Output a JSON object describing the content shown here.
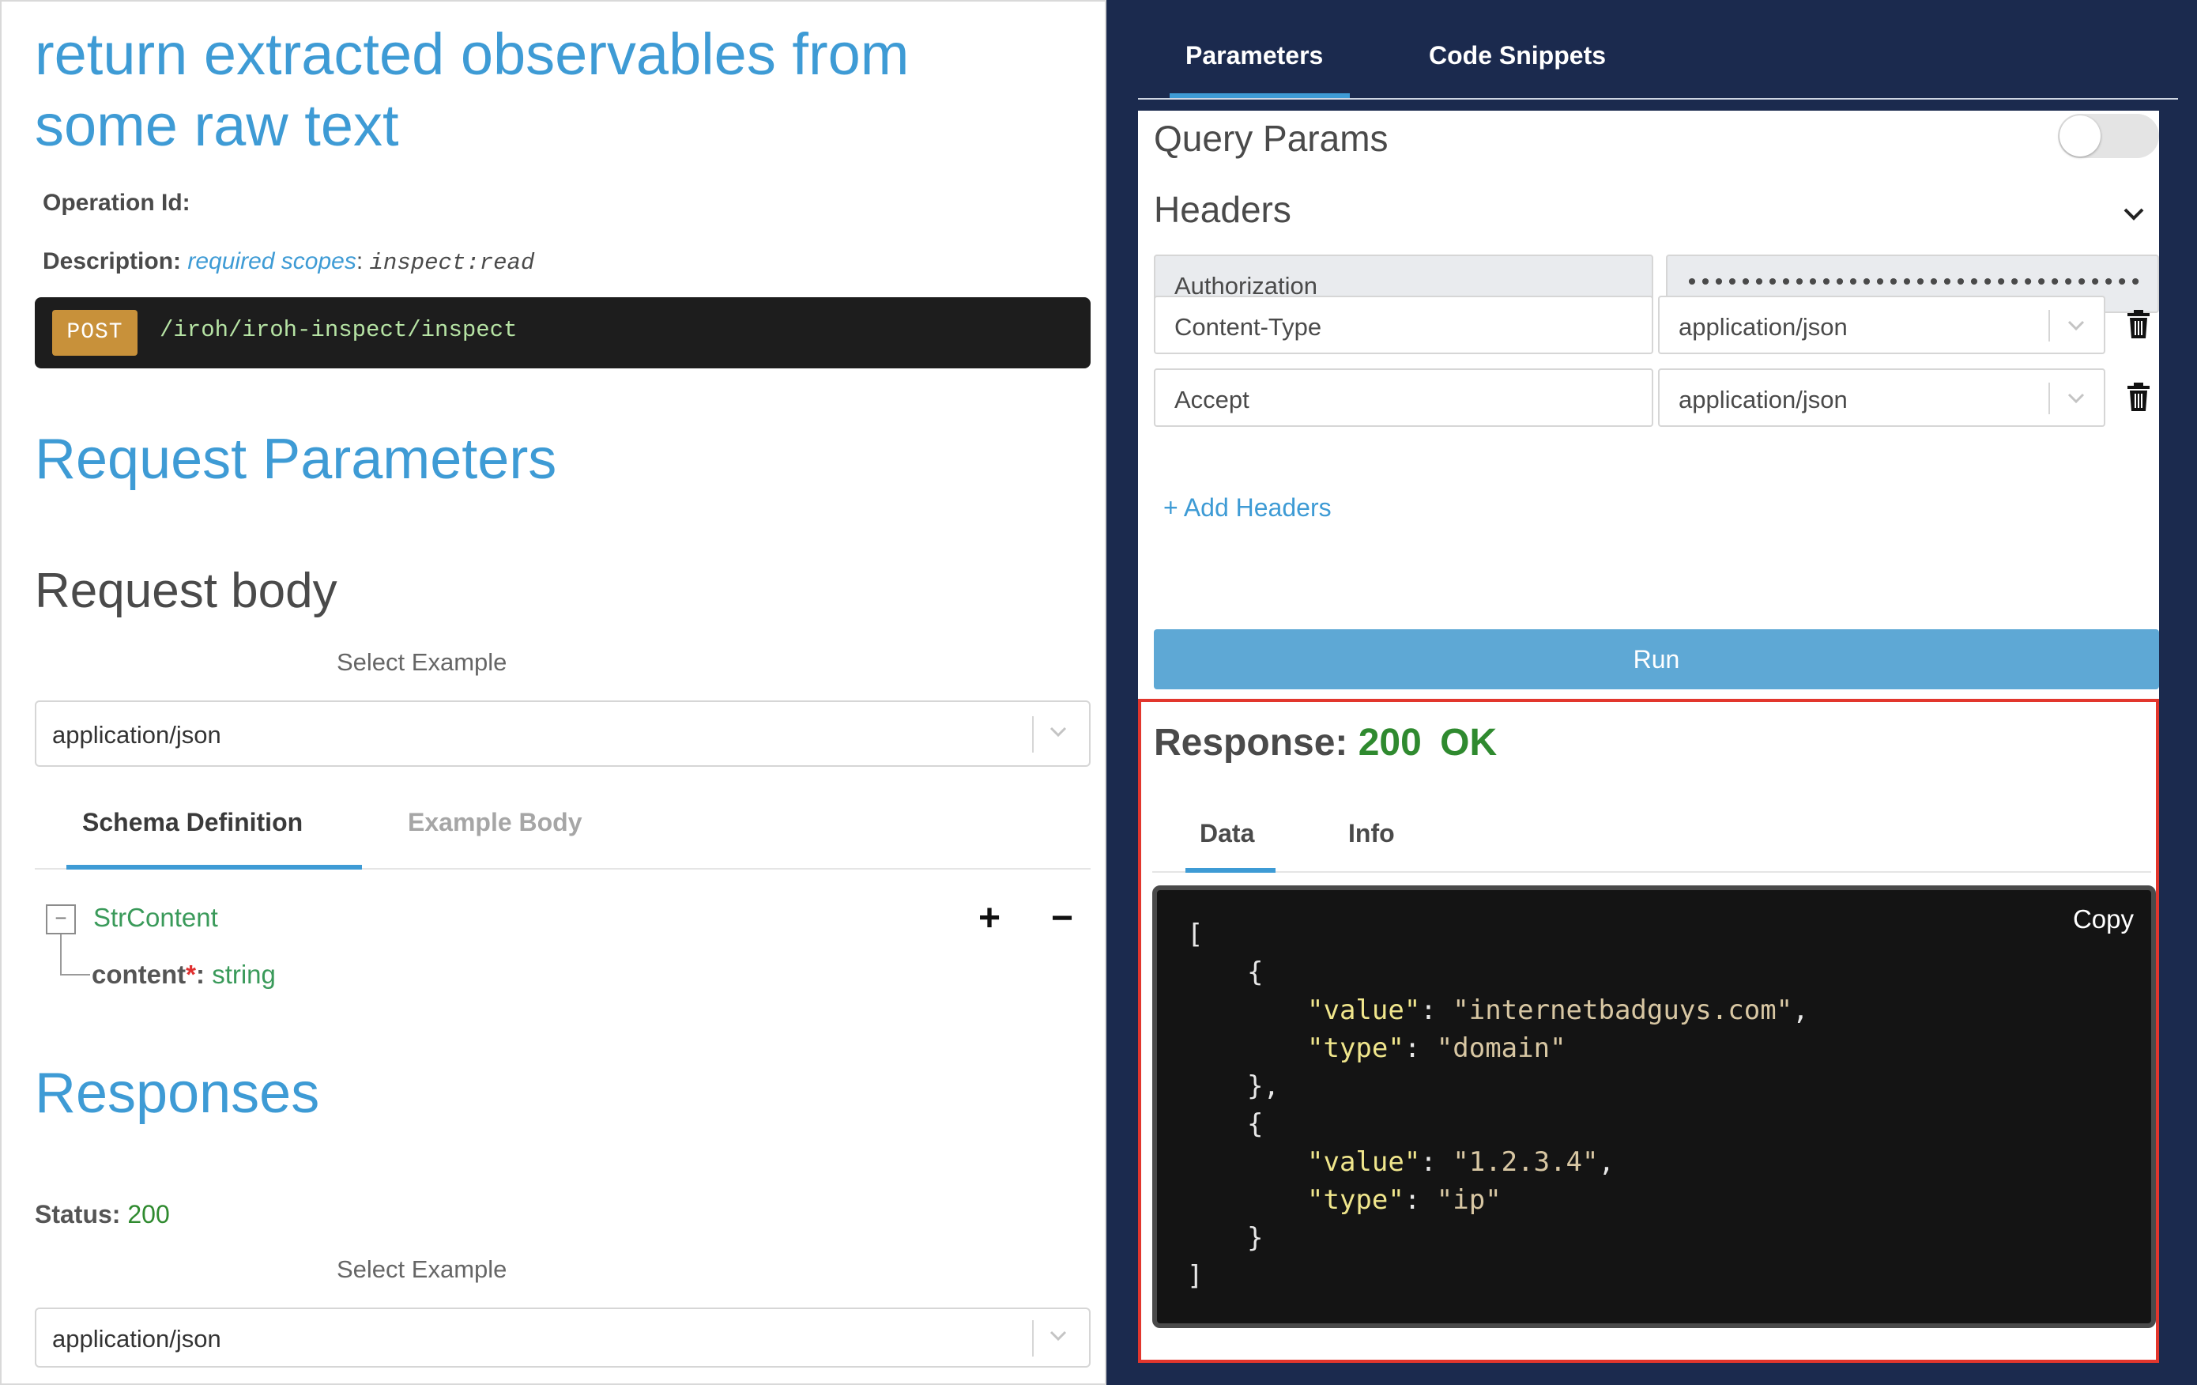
{
  "left": {
    "title": "return extracted observables from some raw text",
    "operation_id_label": "Operation Id:",
    "description_label": "Description:",
    "description_link": "required scopes",
    "description_sep": ": ",
    "description_code": "inspect:read",
    "endpoint": {
      "method": "POST",
      "path": "/iroh/iroh-inspect/inspect"
    },
    "request_parameters_heading": "Request Parameters",
    "request_body_heading": "Request body",
    "select_example_label": "Select Example",
    "request_select_value": "application/json",
    "tabs": [
      {
        "label": "Schema Definition",
        "active": true
      },
      {
        "label": "Example Body",
        "active": false
      }
    ],
    "schema": {
      "collapse_symbol": "−",
      "root": "StrContent",
      "field_name": "content",
      "field_required_marker": "*",
      "field_colon": ":",
      "field_type": "string",
      "expand_all": "+",
      "collapse_all": "−"
    },
    "responses_heading": "Responses",
    "status_label": "Status:",
    "status_value": "200",
    "response_select_example_label": "Select Example",
    "response_select_value": "application/json"
  },
  "right": {
    "tabs": [
      {
        "label": "Parameters",
        "active": true
      },
      {
        "label": "Code Snippets",
        "active": false
      }
    ],
    "query_params_title": "Query Params",
    "query_params_toggle": false,
    "headers_title": "Headers",
    "headers": [
      {
        "key": "Authorization",
        "value": "••••••••••••••••••••••••••••••••••••••••••••••••••••••••••••••••",
        "masked": true,
        "removable": false
      },
      {
        "key": "Content-Type",
        "value": "application/json",
        "masked": false,
        "removable": true
      },
      {
        "key": "Accept",
        "value": "application/json",
        "masked": false,
        "removable": true
      }
    ],
    "add_headers_label": "+ Add Headers",
    "run_label": "Run",
    "response": {
      "label": "Response:",
      "code": "200",
      "status_text": "OK",
      "tabs": [
        {
          "label": "Data",
          "active": true
        },
        {
          "label": "Info",
          "active": false
        }
      ],
      "copy_label": "Copy",
      "json_items": [
        {
          "value": "internetbadguys.com",
          "type": "domain"
        },
        {
          "value": "1.2.3.4",
          "type": "ip"
        }
      ]
    },
    "colors": {
      "accent": "#3e9bd5",
      "navy_background": "#1b2a4e",
      "status_green": "#2f8a2f",
      "response_border": "#e2362d",
      "method_badge": "#c8913a"
    }
  }
}
